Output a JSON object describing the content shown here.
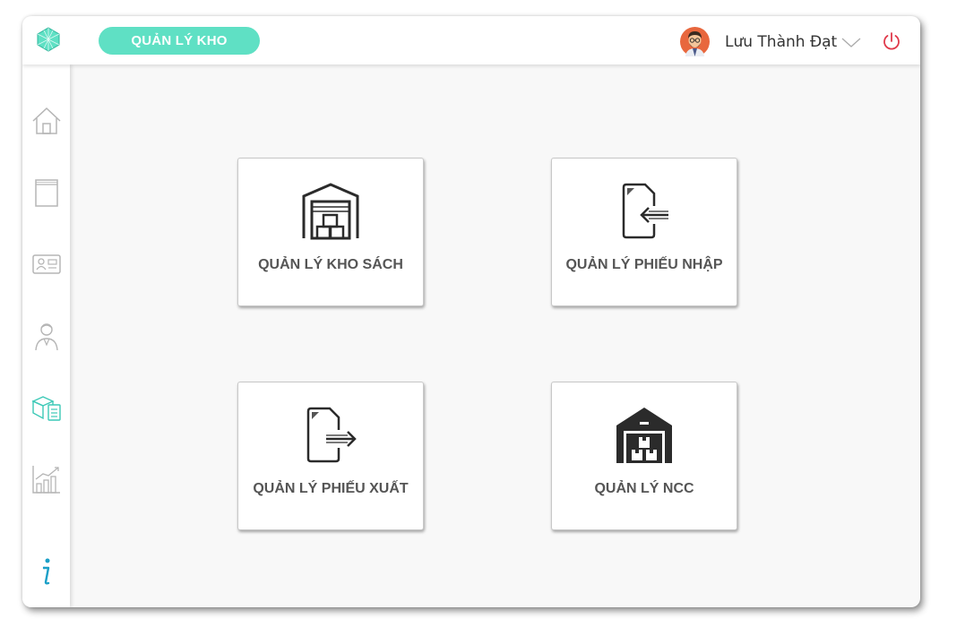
{
  "header": {
    "module_title": "QUẢN LÝ KHO",
    "user_name": "Lưu Thành Đạt"
  },
  "sidebar": {
    "items": [
      {
        "icon": "home-icon",
        "active": false
      },
      {
        "icon": "book-icon",
        "active": false
      },
      {
        "icon": "id-card-icon",
        "active": false
      },
      {
        "icon": "employee-icon",
        "active": false
      },
      {
        "icon": "warehouse-boxes-icon",
        "active": true
      },
      {
        "icon": "chart-icon",
        "active": false
      },
      {
        "icon": "info-icon",
        "active": false
      }
    ]
  },
  "cards": [
    {
      "label": "QUẢN LÝ KHO SÁCH",
      "icon": "warehouse-icon"
    },
    {
      "label": "QUẢN LÝ PHIẾU NHẬP",
      "icon": "file-import-icon"
    },
    {
      "label": "QUẢN LÝ PHIẾU XUẤT",
      "icon": "file-export-icon"
    },
    {
      "label": "QUẢN LÝ NCC",
      "icon": "supplier-warehouse-icon"
    }
  ],
  "colors": {
    "accent": "#5fe0c4",
    "power": "#e0394a",
    "icon_gray": "#b5b5b5",
    "active_icon": "#3cc9b7"
  }
}
